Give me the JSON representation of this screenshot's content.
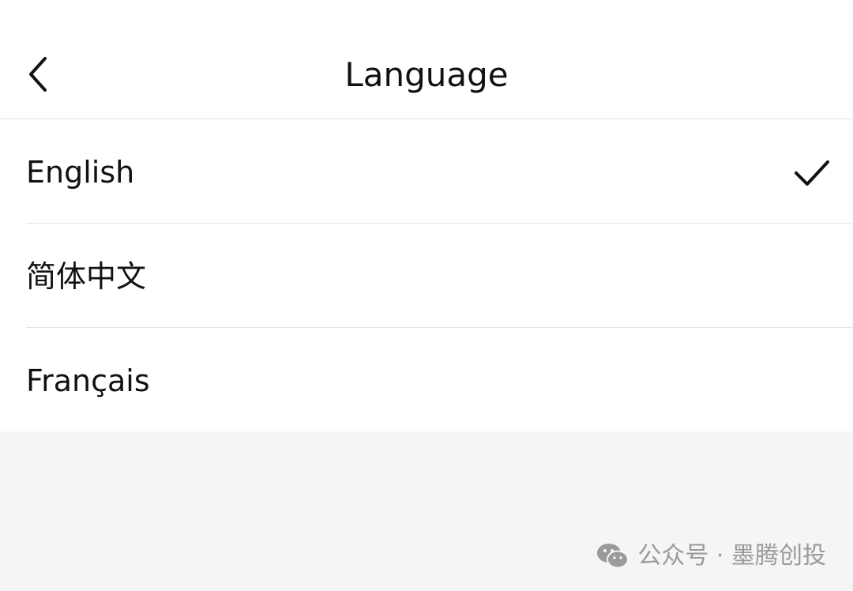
{
  "header": {
    "title": "Language",
    "back_icon": "chevron-left-icon"
  },
  "languages": [
    {
      "label": "English",
      "selected": true
    },
    {
      "label": "简体中文",
      "selected": false
    },
    {
      "label": "Français",
      "selected": false
    }
  ],
  "watermark": {
    "icon": "wechat-icon",
    "text": "公众号 · 墨腾创投"
  },
  "colors": {
    "background": "#f5f5f5",
    "surface": "#ffffff",
    "text": "#111111",
    "divider": "#e4e4e4",
    "watermark": "#9a9a9a"
  }
}
